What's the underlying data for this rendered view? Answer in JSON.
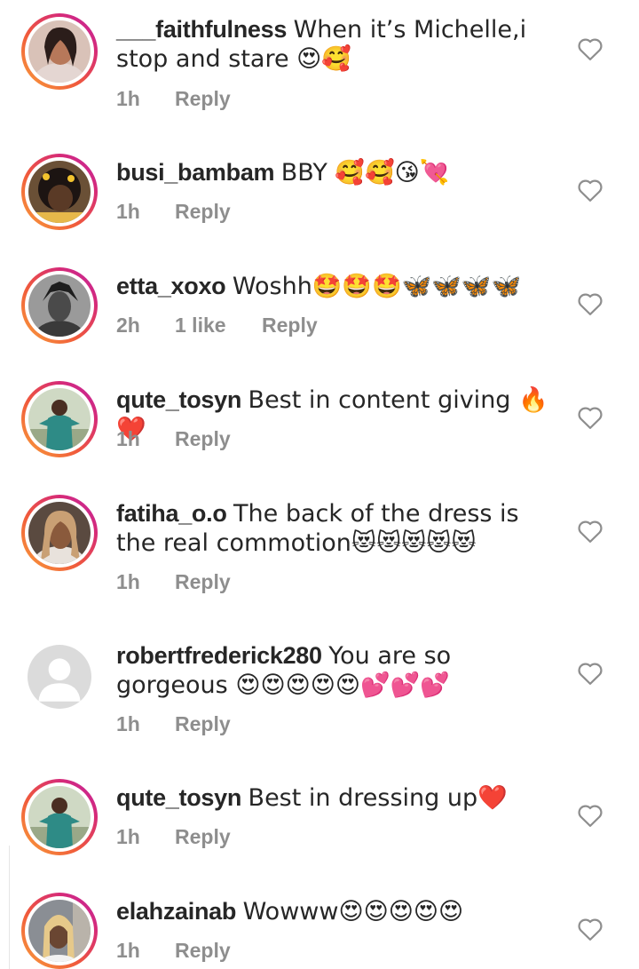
{
  "comments": [
    {
      "username": "___faithfulness",
      "text": "When it’s Michelle,i stop and stare 😍🥰",
      "time": "1h",
      "likes": "",
      "reply": "Reply",
      "avatar": "story-ring"
    },
    {
      "username": "busi_bambam",
      "text": "BBY 🥰🥰😘💘",
      "time": "1h",
      "likes": "",
      "reply": "Reply",
      "avatar": "story-ring"
    },
    {
      "username": "etta_xoxo",
      "text": "Woshh🤩🤩🤩🦋🦋🦋🦋",
      "time": "2h",
      "likes": "1 like",
      "reply": "Reply",
      "avatar": "story-ring"
    },
    {
      "username": "qute_tosyn",
      "text": "Best in content giving 🔥❤️",
      "time": "1h",
      "likes": "",
      "reply": "Reply",
      "avatar": "story-ring"
    },
    {
      "username": "fatiha_o.o",
      "text": "The back of the dress is the real commotion😻😻😻😻😻",
      "time": "1h",
      "likes": "",
      "reply": "Reply",
      "avatar": "story-ring"
    },
    {
      "username": "robertfrederick280",
      "text": "You are so gorgeous 😍😍😍😍😍💕💕💕",
      "time": "1h",
      "likes": "",
      "reply": "Reply",
      "avatar": "default"
    },
    {
      "username": "qute_tosyn",
      "text": "Best in dressing up❤️",
      "time": "1h",
      "likes": "",
      "reply": "Reply",
      "avatar": "story-ring"
    },
    {
      "username": "elahzainab",
      "text": "Wowww😍😍😍😍😍",
      "time": "1h",
      "likes": "",
      "reply": "Reply",
      "avatar": "story-ring"
    }
  ],
  "icons": {
    "like": "heart-outline-icon",
    "default_avatar": "person-silhouette-icon"
  },
  "colors": {
    "text": "#262626",
    "secondary": "#8e8e8e",
    "ring_start": "#f9a23b",
    "ring_end": "#c026a6"
  }
}
